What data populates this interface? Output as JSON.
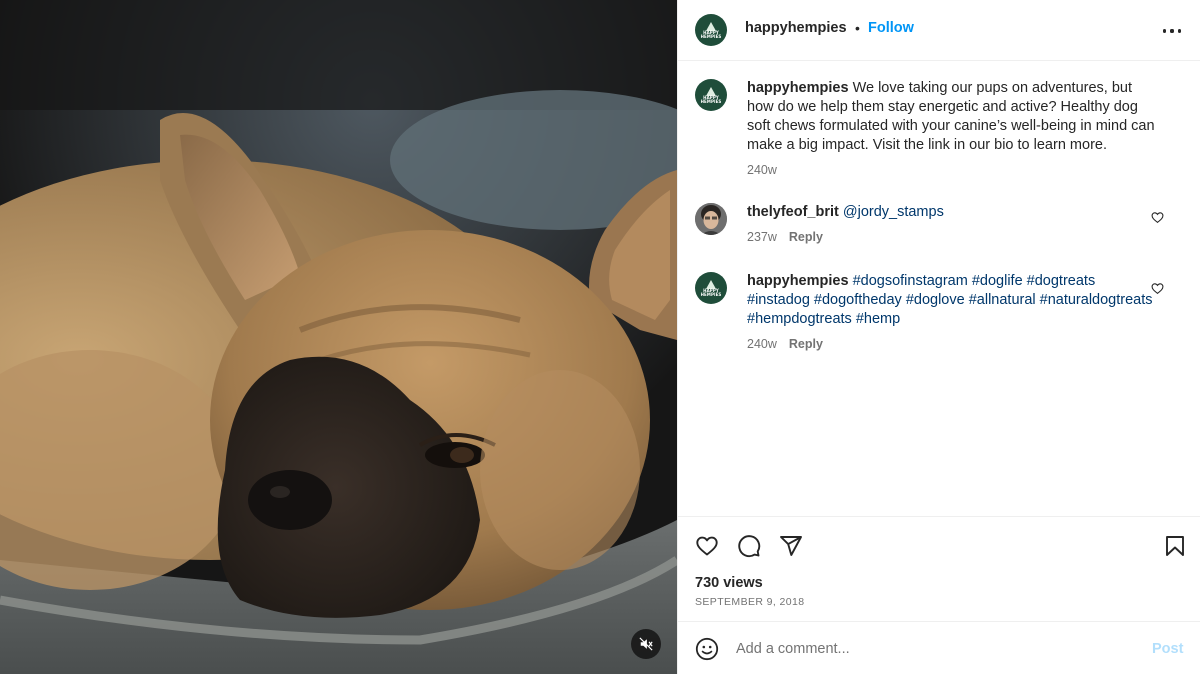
{
  "media": {
    "mute_icon": "speaker-muted-icon"
  },
  "header": {
    "username": "happyhempies",
    "separator": "•",
    "follow_label": "Follow",
    "more_icon": "more-options-icon"
  },
  "brand_avatar": {
    "line1": "HAPPY",
    "line2": "HEMPIES",
    "color": "#1f4d3a"
  },
  "caption": {
    "username": "happyhempies",
    "text": "We love taking our pups on adventures, but how do we help them stay energetic and active? Healthy dog soft chews formulated with your canine’s well-being in mind can make a big impact. Visit the link in our bio to learn more.",
    "time": "240w"
  },
  "comments": [
    {
      "username": "thelyfeof_brit",
      "mention": "@jordy_stamps",
      "time": "237w",
      "reply_label": "Reply"
    },
    {
      "username": "happyhempies",
      "hashtags": "#dogsofinstagram #doglife #dogtreats #instadog #dogoftheday #doglove #allnatural #naturaldogtreats #hempdogtreats #hemp",
      "time": "240w",
      "reply_label": "Reply"
    }
  ],
  "actions": {
    "icons": [
      "heart-icon",
      "comment-icon",
      "share-icon",
      "bookmark-icon"
    ],
    "views": "730 views",
    "date": "SEPTEMBER 9, 2018"
  },
  "add_comment": {
    "placeholder": "Add a comment...",
    "post_label": "Post",
    "post_color": "#b2dffc"
  },
  "colors": {
    "link_blue": "#0095f6",
    "hashtag_blue": "#00376b",
    "secondary_text": "#737373"
  }
}
